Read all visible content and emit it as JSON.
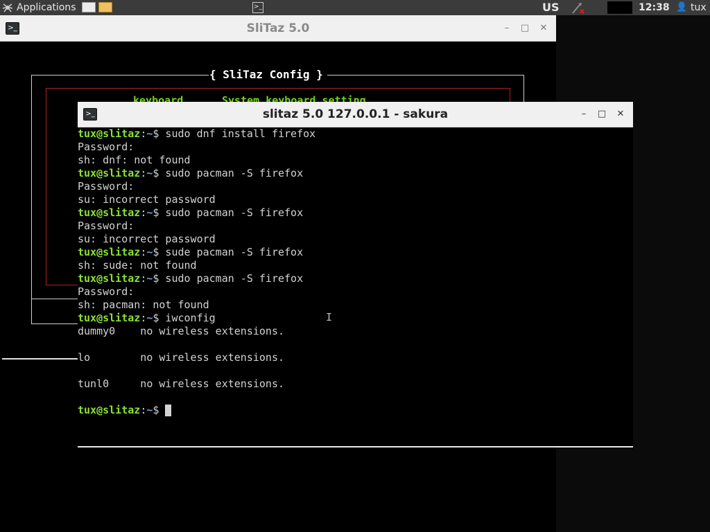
{
  "panel": {
    "apps_label": "Applications",
    "keyboard_layout": "US",
    "clock": "12:38",
    "user": "tux"
  },
  "back_window": {
    "title": "SliTaz 5.0",
    "dialog_title": "{ SliTaz Config }",
    "menu_item_key": "keyboard",
    "menu_item_desc": "System keyboard setting"
  },
  "terminal": {
    "title": "slitaz 5.0 127.0.0.1  - sakura",
    "prompt_user": "tux@slitaz",
    "prompt_colon": ":",
    "prompt_path": "~",
    "prompt_dollar": "$",
    "lines": [
      {
        "type": "cmd",
        "text": " sudo dnf install firefox"
      },
      {
        "type": "out",
        "text": "Password:"
      },
      {
        "type": "out",
        "text": "sh: dnf: not found"
      },
      {
        "type": "cmd",
        "text": " sudo pacman -S firefox"
      },
      {
        "type": "out",
        "text": "Password:"
      },
      {
        "type": "out",
        "text": "su: incorrect password"
      },
      {
        "type": "cmd",
        "text": " sudo pacman -S firefox"
      },
      {
        "type": "out",
        "text": "Password:"
      },
      {
        "type": "out",
        "text": "su: incorrect password"
      },
      {
        "type": "cmd",
        "text": " sude pacman -S firefox"
      },
      {
        "type": "out",
        "text": "sh: sude: not found"
      },
      {
        "type": "cmd",
        "text": " sudo pacman -S firefox"
      },
      {
        "type": "out",
        "text": "Password:"
      },
      {
        "type": "out",
        "text": "sh: pacman: not found"
      },
      {
        "type": "cmd",
        "text": " iwconfig"
      },
      {
        "type": "out",
        "text": "dummy0    no wireless extensions."
      },
      {
        "type": "out",
        "text": ""
      },
      {
        "type": "out",
        "text": "lo        no wireless extensions."
      },
      {
        "type": "out",
        "text": ""
      },
      {
        "type": "out",
        "text": "tunl0     no wireless extensions."
      },
      {
        "type": "out",
        "text": ""
      },
      {
        "type": "cmd",
        "text": " "
      }
    ]
  },
  "colors": {
    "panel_bg": "#3b3b3b",
    "prompt_user": "#8ae234",
    "prompt_path": "#729fcf",
    "dialog_border": "#aa2222"
  }
}
